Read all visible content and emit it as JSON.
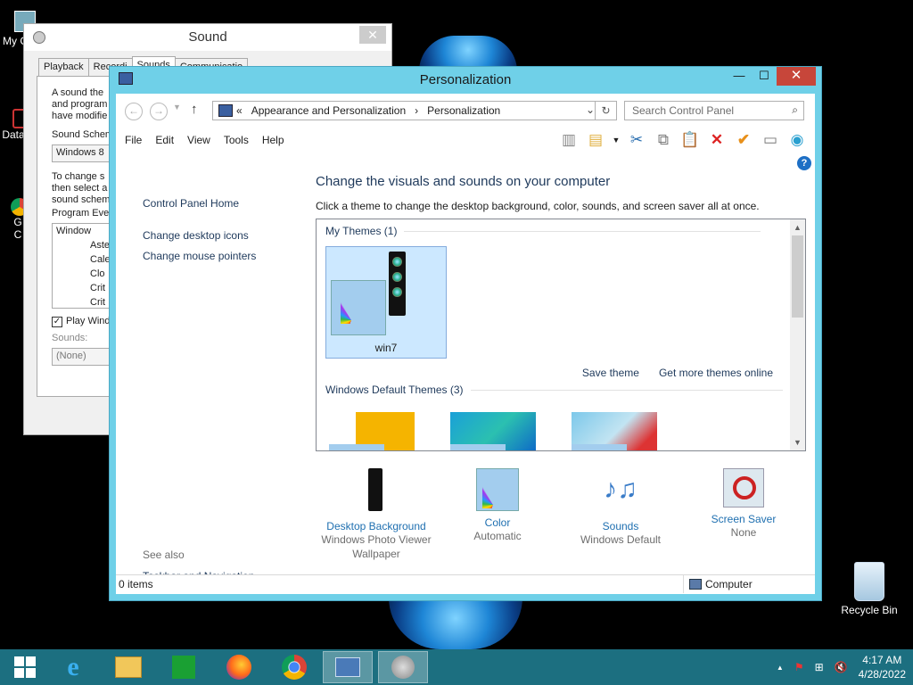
{
  "desktop": {
    "icons": [
      {
        "label": "My C",
        "name": "my-computer"
      },
      {
        "label": "Data",
        "name": "data"
      },
      {
        "label": "G\nC",
        "name": "google-chrome"
      }
    ],
    "recycle_bin_label": "Recycle Bin"
  },
  "sound_window": {
    "title": "Sound",
    "close_label": "✕",
    "tabs": [
      "Playback",
      "Recordi",
      "Sounds",
      "Communicatio"
    ],
    "intro_lines": [
      "A sound the",
      "and program",
      "have modifie"
    ],
    "scheme_label": "Sound Schem",
    "scheme_value": "Windows 8",
    "change_lines": [
      "To change s",
      "then select a",
      "sound schem"
    ],
    "program_events_label": "Program Eve",
    "events": [
      "Window",
      "Aste",
      "Cale",
      "Clo",
      "Crit",
      "Crit"
    ],
    "play_label": "Play Wind",
    "sounds_label": "Sounds:",
    "sounds_value": "(None)"
  },
  "personalization": {
    "title": "Personalization",
    "breadcrumb_prefix": "«",
    "breadcrumb": [
      "Appearance and Personalization",
      "Personalization"
    ],
    "search_placeholder": "Search Control Panel",
    "menu": [
      "File",
      "Edit",
      "View",
      "Tools",
      "Help"
    ],
    "left_nav": [
      "Control Panel Home",
      "Change desktop icons",
      "Change mouse pointers"
    ],
    "see_also_label": "See also",
    "see_also_links": [
      "Taskbar and Navigation"
    ],
    "heading": "Change the visuals and sounds on your computer",
    "subheading": "Click a theme to change the desktop background, color, sounds, and screen saver all at once.",
    "my_themes_label": "My Themes (1)",
    "my_theme_name": "win7",
    "save_theme": "Save theme",
    "get_more": "Get more themes online",
    "default_themes_label": "Windows Default Themes (3)",
    "bottom_items": [
      {
        "name": "desktop-background",
        "link": "Desktop Background",
        "sub": "Windows Photo Viewer Wallpaper"
      },
      {
        "name": "color",
        "link": "Color",
        "sub": "Automatic"
      },
      {
        "name": "sounds",
        "link": "Sounds",
        "sub": "Windows Default"
      },
      {
        "name": "screen-saver",
        "link": "Screen Saver",
        "sub": "None"
      }
    ],
    "status_items": "0 items",
    "status_location": "Computer"
  },
  "taskbar": {
    "clock_time": "4:17 AM",
    "clock_date": "4/28/2022",
    "tray_arrow": "▲"
  }
}
